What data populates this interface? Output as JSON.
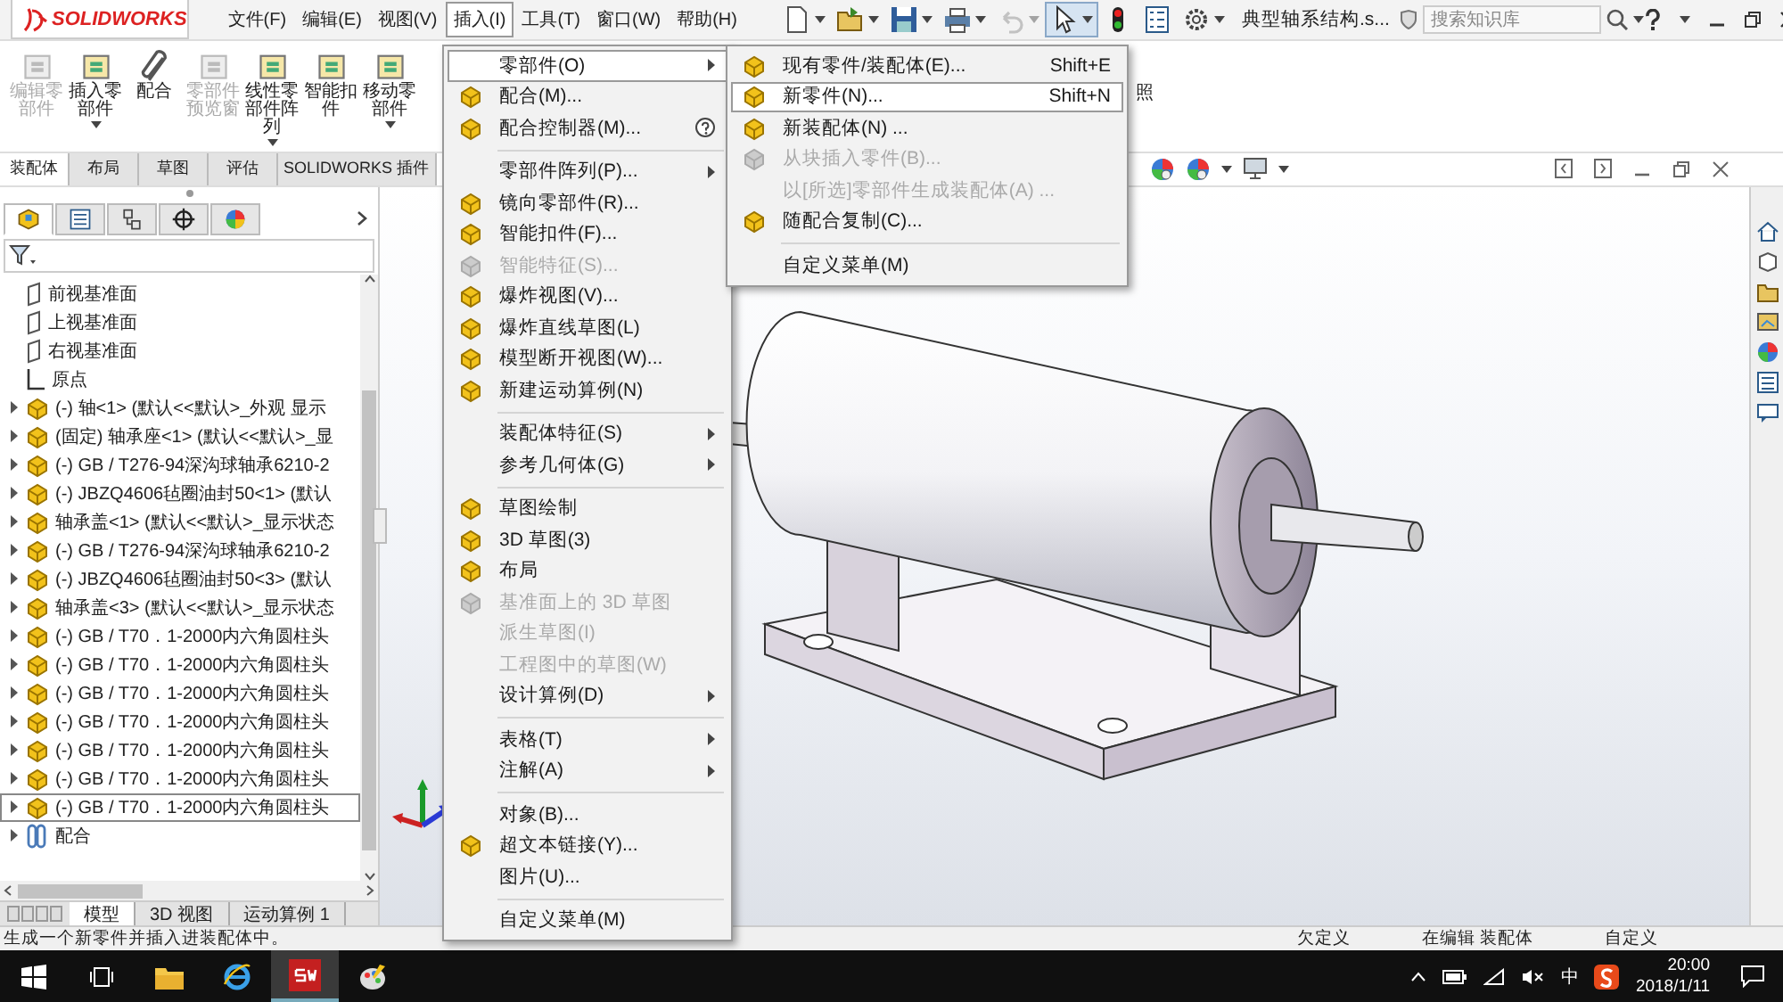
{
  "app": {
    "logo_text": "SOLIDWORKS"
  },
  "menubar": [
    {
      "label": "文件(F)",
      "selected": false
    },
    {
      "label": "编辑(E)",
      "selected": false
    },
    {
      "label": "视图(V)",
      "selected": false
    },
    {
      "label": "插入(I)",
      "selected": true
    },
    {
      "label": "工具(T)",
      "selected": false
    },
    {
      "label": "窗口(W)",
      "selected": false
    },
    {
      "label": "帮助(H)",
      "selected": false
    }
  ],
  "toolbar": [
    {
      "kind": "new",
      "disabled": false,
      "pressed": false
    },
    {
      "kind": "open",
      "disabled": false,
      "pressed": false
    },
    {
      "kind": "save",
      "disabled": false,
      "pressed": false
    },
    {
      "kind": "print",
      "disabled": false,
      "pressed": false
    },
    {
      "kind": "undo",
      "disabled": true,
      "pressed": false
    },
    {
      "kind": "select",
      "disabled": false,
      "pressed": true
    },
    {
      "kind": "rebuild",
      "disabled": false,
      "pressed": false
    },
    {
      "kind": "properties",
      "disabled": false,
      "pressed": false
    },
    {
      "kind": "options",
      "disabled": false,
      "pressed": false
    }
  ],
  "document_title": "典型轴系结构.s...",
  "search": {
    "placeholder": "搜索知识库"
  },
  "command_bar": {
    "buttons": [
      {
        "label": "编辑零部件",
        "disabled": true,
        "dropdown": false
      },
      {
        "label": "插入零部件",
        "disabled": false,
        "dropdown": true
      },
      {
        "label": "配合",
        "disabled": false,
        "dropdown": false
      },
      {
        "label": "零部件预览窗",
        "disabled": true,
        "dropdown": false
      },
      {
        "label": "线性零部件阵列",
        "disabled": false,
        "dropdown": true
      },
      {
        "label": "智能扣件",
        "disabled": false,
        "dropdown": false
      },
      {
        "label": "移动零部件",
        "disabled": false,
        "dropdown": true
      }
    ],
    "partial_label": "照"
  },
  "tabs": [
    {
      "label": "装配体",
      "selected": true
    },
    {
      "label": "布局",
      "selected": false
    },
    {
      "label": "草图",
      "selected": false
    },
    {
      "label": "评估",
      "selected": false
    },
    {
      "label": "SOLIDWORKS 插件",
      "selected": false
    }
  ],
  "feature_tree": {
    "panel_tabs": [
      {
        "kind": "feature",
        "selected": true
      },
      {
        "kind": "property",
        "selected": false
      },
      {
        "kind": "configuration",
        "selected": false
      },
      {
        "kind": "dimension",
        "selected": false
      },
      {
        "kind": "display",
        "selected": false
      }
    ],
    "items": [
      {
        "label": "前视基准面",
        "kind": "plane",
        "expandable": false,
        "selected": false
      },
      {
        "label": "上视基准面",
        "kind": "plane",
        "expandable": false,
        "selected": false
      },
      {
        "label": "右视基准面",
        "kind": "plane",
        "expandable": false,
        "selected": false
      },
      {
        "label": "原点",
        "kind": "origin",
        "expandable": false,
        "selected": false
      },
      {
        "label": "(-) 轴<1> (默认<<默认>_外观 显示",
        "kind": "part",
        "expandable": true,
        "selected": false
      },
      {
        "label": "(固定) 轴承座<1> (默认<<默认>_显",
        "kind": "part",
        "expandable": true,
        "selected": false
      },
      {
        "label": "(-) GB / T276-94深沟球轴承6210-2",
        "kind": "part",
        "expandable": true,
        "selected": false
      },
      {
        "label": "(-) JBZQ4606毡圈油封50<1> (默认",
        "kind": "part",
        "expandable": true,
        "selected": false
      },
      {
        "label": "轴承盖<1> (默认<<默认>_显示状态",
        "kind": "part",
        "expandable": true,
        "selected": false
      },
      {
        "label": "(-) GB / T276-94深沟球轴承6210-2",
        "kind": "part",
        "expandable": true,
        "selected": false
      },
      {
        "label": "(-) JBZQ4606毡圈油封50<3> (默认",
        "kind": "part",
        "expandable": true,
        "selected": false
      },
      {
        "label": "轴承盖<3> (默认<<默认>_显示状态",
        "kind": "part",
        "expandable": true,
        "selected": false
      },
      {
        "label": "(-) GB / T70．1-2000内六角圆柱头",
        "kind": "part",
        "expandable": true,
        "selected": false
      },
      {
        "label": "(-) GB / T70．1-2000内六角圆柱头",
        "kind": "part",
        "expandable": true,
        "selected": false
      },
      {
        "label": "(-) GB / T70．1-2000内六角圆柱头",
        "kind": "part",
        "expandable": true,
        "selected": false
      },
      {
        "label": "(-) GB / T70．1-2000内六角圆柱头",
        "kind": "part",
        "expandable": true,
        "selected": false
      },
      {
        "label": "(-) GB / T70．1-2000内六角圆柱头",
        "kind": "part",
        "expandable": true,
        "selected": false
      },
      {
        "label": "(-) GB / T70．1-2000内六角圆柱头",
        "kind": "part",
        "expandable": true,
        "selected": false
      },
      {
        "label": "(-) GB / T70．1-2000内六角圆柱头",
        "kind": "part",
        "expandable": true,
        "selected": true
      },
      {
        "label": "配合",
        "kind": "mates",
        "expandable": true,
        "selected": false
      }
    ],
    "bottom_tabs": [
      {
        "label": "模型",
        "selected": true
      },
      {
        "label": "3D 视图",
        "selected": false
      },
      {
        "label": "运动算例 1",
        "selected": false
      }
    ]
  },
  "insert_menu": {
    "items": [
      {
        "kind": "item",
        "label": "零部件(O)",
        "icon": false,
        "submenu": true,
        "disabled": false,
        "selected": true,
        "help": false
      },
      {
        "kind": "item",
        "label": "配合(M)...",
        "icon": true,
        "submenu": false,
        "disabled": false,
        "selected": false,
        "help": false
      },
      {
        "kind": "item",
        "label": "配合控制器(M)...",
        "icon": true,
        "submenu": false,
        "disabled": false,
        "selected": false,
        "help": true
      },
      {
        "kind": "separator"
      },
      {
        "kind": "item",
        "label": "零部件阵列(P)...",
        "icon": false,
        "submenu": true,
        "disabled": false,
        "selected": false,
        "help": false
      },
      {
        "kind": "item",
        "label": "镜向零部件(R)...",
        "icon": true,
        "submenu": false,
        "disabled": false,
        "selected": false,
        "help": false
      },
      {
        "kind": "item",
        "label": "智能扣件(F)...",
        "icon": true,
        "submenu": false,
        "disabled": false,
        "selected": false,
        "help": false
      },
      {
        "kind": "item",
        "label": "智能特征(S)...",
        "icon": true,
        "submenu": false,
        "disabled": true,
        "selected": false,
        "help": false
      },
      {
        "kind": "item",
        "label": "爆炸视图(V)...",
        "icon": true,
        "submenu": false,
        "disabled": false,
        "selected": false,
        "help": false
      },
      {
        "kind": "item",
        "label": "爆炸直线草图(L)",
        "icon": true,
        "submenu": false,
        "disabled": false,
        "selected": false,
        "help": false
      },
      {
        "kind": "item",
        "label": "模型断开视图(W)...",
        "icon": true,
        "submenu": false,
        "disabled": false,
        "selected": false,
        "help": false
      },
      {
        "kind": "item",
        "label": "新建运动算例(N)",
        "icon": true,
        "submenu": false,
        "disabled": false,
        "selected": false,
        "help": false
      },
      {
        "kind": "separator"
      },
      {
        "kind": "item",
        "label": "装配体特征(S)",
        "icon": false,
        "submenu": true,
        "disabled": false,
        "selected": false,
        "help": false
      },
      {
        "kind": "item",
        "label": "参考几何体(G)",
        "icon": false,
        "submenu": true,
        "disabled": false,
        "selected": false,
        "help": false
      },
      {
        "kind": "separator"
      },
      {
        "kind": "item",
        "label": "草图绘制",
        "icon": true,
        "submenu": false,
        "disabled": false,
        "selected": false,
        "help": false
      },
      {
        "kind": "item",
        "label": "3D 草图(3)",
        "icon": true,
        "submenu": false,
        "disabled": false,
        "selected": false,
        "help": false
      },
      {
        "kind": "item",
        "label": "布局",
        "icon": true,
        "submenu": false,
        "disabled": false,
        "selected": false,
        "help": false
      },
      {
        "kind": "item",
        "label": "基准面上的 3D 草图",
        "icon": true,
        "submenu": false,
        "disabled": true,
        "selected": false,
        "help": false
      },
      {
        "kind": "item",
        "label": "派生草图(I)",
        "icon": false,
        "submenu": false,
        "disabled": true,
        "selected": false,
        "help": false
      },
      {
        "kind": "item",
        "label": "工程图中的草图(W)",
        "icon": false,
        "submenu": false,
        "disabled": true,
        "selected": false,
        "help": false
      },
      {
        "kind": "item",
        "label": "设计算例(D)",
        "icon": false,
        "submenu": true,
        "disabled": false,
        "selected": false,
        "help": false
      },
      {
        "kind": "separator"
      },
      {
        "kind": "item",
        "label": "表格(T)",
        "icon": false,
        "submenu": true,
        "disabled": false,
        "selected": false,
        "help": false
      },
      {
        "kind": "item",
        "label": "注解(A)",
        "icon": false,
        "submenu": true,
        "disabled": false,
        "selected": false,
        "help": false
      },
      {
        "kind": "separator"
      },
      {
        "kind": "item",
        "label": "对象(B)...",
        "icon": false,
        "submenu": false,
        "disabled": false,
        "selected": false,
        "help": false
      },
      {
        "kind": "item",
        "label": "超文本链接(Y)...",
        "icon": true,
        "submenu": false,
        "disabled": false,
        "selected": false,
        "help": false
      },
      {
        "kind": "item",
        "label": "图片(U)...",
        "icon": false,
        "submenu": false,
        "disabled": false,
        "selected": false,
        "help": false
      },
      {
        "kind": "separator"
      },
      {
        "kind": "item",
        "label": "自定义菜单(M)",
        "icon": false,
        "submenu": false,
        "disabled": false,
        "selected": false,
        "help": false
      }
    ]
  },
  "component_submenu": {
    "items": [
      {
        "kind": "item",
        "label": "现有零件/装配体(E)...",
        "shortcut": "Shift+E",
        "icon": true,
        "disabled": false,
        "selected": false
      },
      {
        "kind": "item",
        "label": "新零件(N)...",
        "shortcut": "Shift+N",
        "icon": true,
        "disabled": false,
        "selected": true
      },
      {
        "kind": "item",
        "label": "新装配体(N) ...",
        "icon": true,
        "disabled": false,
        "selected": false
      },
      {
        "kind": "item",
        "label": "从块插入零件(B)...",
        "icon": true,
        "disabled": true,
        "selected": false
      },
      {
        "kind": "item",
        "label": "以[所选]零部件生成装配体(A) ...",
        "icon": false,
        "disabled": true,
        "selected": false
      },
      {
        "kind": "item",
        "label": "随配合复制(C)...",
        "icon": true,
        "disabled": false,
        "selected": false
      },
      {
        "kind": "separator"
      },
      {
        "kind": "item",
        "label": "自定义菜单(M)",
        "icon": false,
        "disabled": false,
        "selected": false
      }
    ]
  },
  "status_bar": {
    "message": "生成一个新零件并插入进装配体中。",
    "fields": [
      "欠定义",
      "在编辑 装配体",
      "自定义"
    ]
  },
  "taskbar": {
    "ime": "中",
    "time": "20:00",
    "date": "2018/1/11"
  }
}
